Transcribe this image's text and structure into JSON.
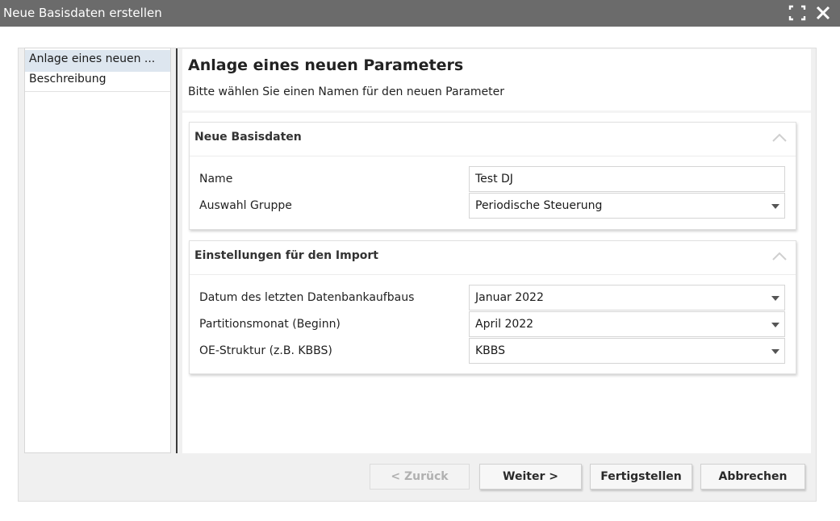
{
  "window": {
    "title": "Neue Basisdaten erstellen",
    "maximize_icon": "maximize-icon",
    "close_icon": "close-icon",
    "titlebar_color": "#6b6b6b"
  },
  "nav": {
    "items": [
      {
        "label": "Anlage eines neuen ...",
        "selected": true
      },
      {
        "label": "Beschreibung",
        "selected": false
      }
    ]
  },
  "header": {
    "title": "Anlage eines neuen Parameters",
    "subtitle": "Bitte wählen Sie einen Namen für den neuen Parameter"
  },
  "panel_basisdaten": {
    "title": "Neue Basisdaten",
    "rows": [
      {
        "label": "Name",
        "value": "Test DJ",
        "type": "text"
      },
      {
        "label": "Auswahl Gruppe",
        "value": "Periodische Steuerung",
        "type": "select"
      }
    ]
  },
  "panel_import": {
    "title": "Einstellungen für den Import",
    "rows": [
      {
        "label": "Datum des letzten Datenbankaufbaus",
        "value": "Januar 2022",
        "type": "select"
      },
      {
        "label": "Partitionsmonat (Beginn)",
        "value": "April 2022",
        "type": "select"
      },
      {
        "label": "OE-Struktur (z.B. KBBS)",
        "value": "KBBS",
        "type": "select"
      }
    ]
  },
  "buttons": {
    "back": "< Zurück",
    "next": "Weiter >",
    "finish": "Fertigstellen",
    "cancel": "Abbrechen"
  }
}
